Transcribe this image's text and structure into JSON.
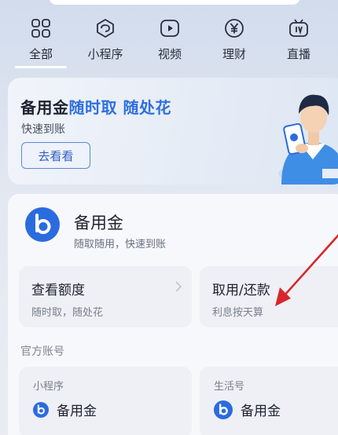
{
  "tabs": [
    {
      "label": "全部",
      "icon": "grid-icon",
      "active": true
    },
    {
      "label": "小程序",
      "icon": "mini-program-icon",
      "active": false
    },
    {
      "label": "视频",
      "icon": "video-play-icon",
      "active": false
    },
    {
      "label": "理财",
      "icon": "yen-coin-icon",
      "active": false
    },
    {
      "label": "直播",
      "icon": "live-tv-icon",
      "active": false
    }
  ],
  "promo": {
    "title_part1": "备用金",
    "title_part2": "随时取 随处花",
    "subtitle": "快速到账",
    "button_label": "去看看",
    "accent_color": "#2f6fe0"
  },
  "service": {
    "name": "备用金",
    "description": "随取随用，快速到账",
    "brand_color": "#2a6be0",
    "actions": [
      {
        "title": "查看额度",
        "subtitle": "随时取，随处花"
      },
      {
        "title": "取用/还款",
        "subtitle": "利息按天算"
      }
    ]
  },
  "accounts": {
    "section_label": "官方账号",
    "items": [
      {
        "type": "小程序",
        "name": "备用金"
      },
      {
        "type": "生活号",
        "name": "备用金"
      }
    ]
  },
  "annotation": {
    "arrow_color": "#d9262b"
  }
}
